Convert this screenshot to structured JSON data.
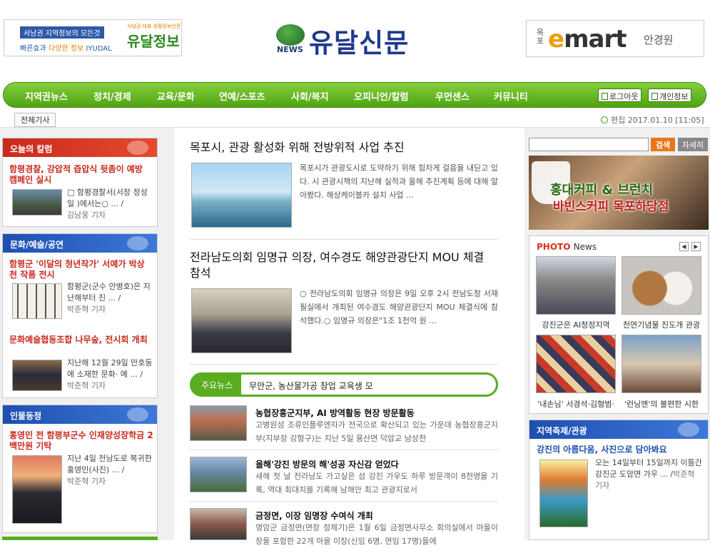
{
  "header": {
    "left_banner": {
      "line1": "서남권 지역정보의 모든것",
      "line2_a": "빠른효과",
      "line2_b": "다양한 정보",
      "line2_c": "IYUDAL",
      "brand": "유달정보",
      "brand_sub": "서남권 대표 생활정보신문"
    },
    "logo": {
      "news": "NEWS",
      "title": "유달신문"
    },
    "right_banner": {
      "prefix": "목포",
      "e": "e",
      "mart": "mart",
      "store": "안경원"
    }
  },
  "nav": {
    "items": [
      "지역권뉴스",
      "정치/경제",
      "교육/문화",
      "연예/스포츠",
      "사회/복지",
      "오피니언/칼럼",
      "우먼센스",
      "커뮤니티"
    ],
    "logout": "로그아웃",
    "profile": "개인정보"
  },
  "subbar": {
    "all_articles": "전체기사",
    "edit_time": "편집 2017.01.10 [11:05]"
  },
  "left": {
    "column": {
      "header": "오늘의 칼럼",
      "title": "함평경찰, 강압적 즙압식 뒷좀이 예방 캠페인 실시",
      "text": "□ 함평경찰서(서장 정성일 )에서는○ ... /",
      "reporter": "김남웅 기자"
    },
    "culture": {
      "header": "문화/예술/공연",
      "a1_title": "함평군 '이달의 청년작가' 서예가 박상천 작품 전시",
      "a1_text": "함평군(군수 안병호)은 지난해부터 진 ... /",
      "a1_reporter": "박준혁 기자",
      "a2_title": "문화예술협동조합 나무숲, 전시회 개최",
      "a2_text": "지난해 12월 29일 만호동에 소재한 문화· 예 ... /",
      "a2_reporter": "박준혁 기자"
    },
    "people": {
      "header": "인물동정",
      "title": "홍영민 전 함평부군수 인재양성장학금 2백만원 기탁",
      "text": "지난 4일 전남도로 복귀한 홍영민(사진) ... /",
      "reporter": "박준혁 기자"
    }
  },
  "center": {
    "top1": {
      "title": "목포시, 관광 활성화 위해 전방위적 사업 추진",
      "text": "목포시가 관광도시로 도약하기 위해 힘차게 걸음을 내딛고 있다. 시 관광시책의 지난해 실적과 올해 추진계획 등에 대해 알아봤다. 해상케이블카 설치 사업 ..."
    },
    "top2": {
      "title": "전라남도의회 임명규 의장, 여수경도 해양관광단지 MOU 체결 참석",
      "text": "○ 전라남도의회 임명규 의장은 9일 오후 2시 전남도청 서재필실에서 개최된 여수경도 해양관광단지 MOU 체결식에 참석했다.○ 임명규 의장은\"1조 1천억 원 ..."
    },
    "main_news": {
      "label": "주요뉴스",
      "ticker": "무안군, 농산물가공 창업 교육생 모"
    },
    "news": [
      {
        "title": "농협장흥군지부, AI 방역활동 현장 방문활동",
        "text": "고병원성 조류인플루엔자가 전국으로 확산되고 있는 가운데 농협장흥군지부(지부장 강형구)는 지난 5일 용산면 덕압교 남상천"
      },
      {
        "title": "올해'강진 방문의 해'성공 자신감 얻었다",
        "text": "새해 첫 날 전라남도 가고싶은 섬 강진 가우도 하루 방문객이 8천명을 기록, 역대 최대치를 기록해 남해안 최고 관광지로서"
      },
      {
        "title": "금정면, 이장 임명장 수여식 개최",
        "text": "영암군 금정면(면장 정제기)은 1월 6일 금정면사무소 회의실에서 마을이장을 포함한 22개 마을 이장(신임 6명, 연임 17명)들에"
      }
    ]
  },
  "right": {
    "search": {
      "button": "검색",
      "detail": "자세히",
      "placeholder": ""
    },
    "cafe_ad": {
      "line1": "홍대커피 & 브런치",
      "line2": "바빈스커피 목포하당점"
    },
    "photo": {
      "header_a": "PHOTO",
      "header_b": "News",
      "prev": "◀",
      "next": "▶",
      "captions": [
        "강진군은 AI청정지역",
        "천연기념물 진도개 관광",
        "'내손님' 서경석·김형범·",
        "'런닝맨'의 불편한 시한"
      ]
    },
    "festival": {
      "header": "지역축제/관광",
      "title": "강진의 아름다움, 사진으로 담아봐요",
      "text": "오는 14일부터 15일까지 이틀간 강진군 도암면 가우 ... /",
      "reporter": "박준혁 기자"
    }
  }
}
